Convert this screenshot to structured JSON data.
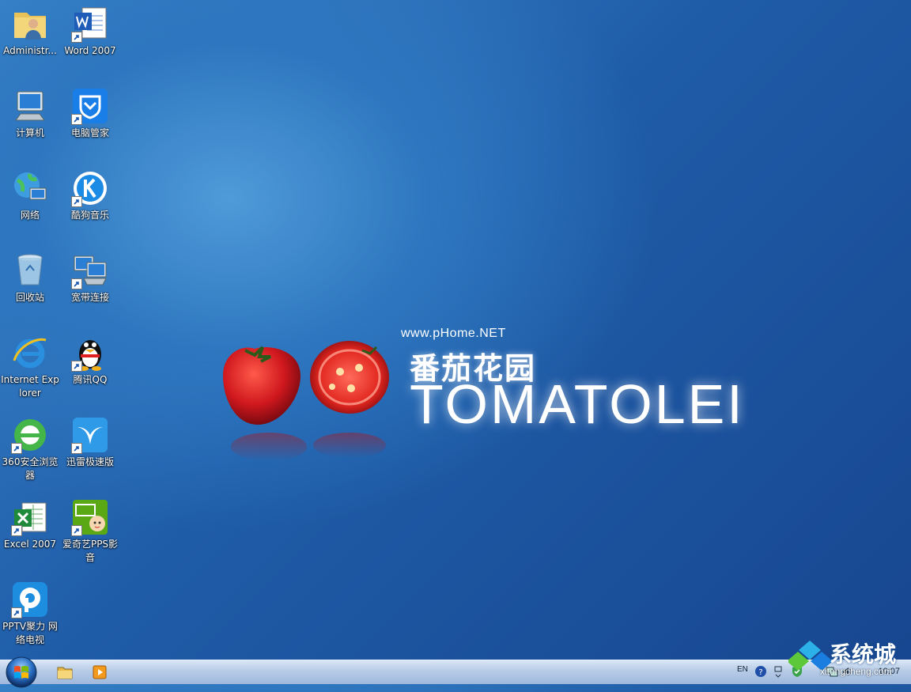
{
  "desktop_icons": [
    {
      "label": "Administr...",
      "icon": "user-folder-icon"
    },
    {
      "label": "Word 2007",
      "icon": "word-icon"
    },
    {
      "label": "计算机",
      "icon": "computer-icon"
    },
    {
      "label": "电脑管家",
      "icon": "pc-manager-icon"
    },
    {
      "label": "网络",
      "icon": "network-icon"
    },
    {
      "label": "酷狗音乐",
      "icon": "kugou-music-icon"
    },
    {
      "label": "回收站",
      "icon": "recycle-bin-icon"
    },
    {
      "label": "宽带连接",
      "icon": "broadband-connection-icon"
    },
    {
      "label": "Internet Explorer",
      "icon": "internet-explorer-icon"
    },
    {
      "label": "腾讯QQ",
      "icon": "qq-penguin-icon"
    },
    {
      "label": "360安全浏览器",
      "icon": "browser-360-icon"
    },
    {
      "label": "迅雷极速版",
      "icon": "xunlei-icon"
    },
    {
      "label": "Excel 2007",
      "icon": "excel-icon"
    },
    {
      "label": "爱奇艺PPS影音",
      "icon": "iqiyi-pps-icon"
    },
    {
      "label": "PPTV聚力 网络电视",
      "icon": "pptv-icon"
    }
  ],
  "wallpaper": {
    "url_text": "www.pHome.NET",
    "title_cn": "番茄花园",
    "title_en": "TOMATOLEI"
  },
  "taskbar": {
    "tray_lang": "EN",
    "clock": "10:07"
  },
  "watermark": {
    "text": "系统城",
    "url": "xitongcheng.com"
  },
  "colors": {
    "desktop_blue": "#1f5ca8",
    "taskbar": "#b6cbe6",
    "tomato_red": "#d0181e"
  }
}
